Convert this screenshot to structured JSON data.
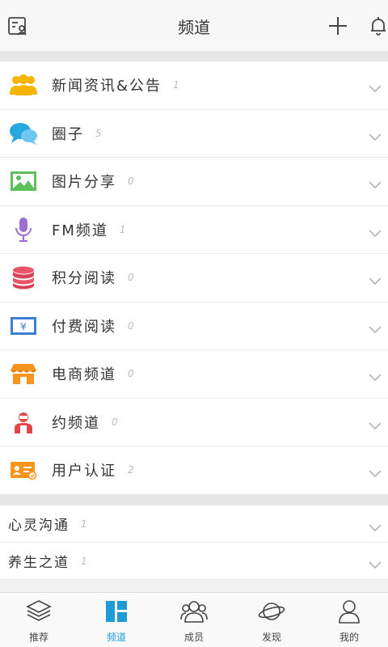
{
  "header": {
    "title": "频道"
  },
  "channels": [
    {
      "label": "新闻资讯&公告",
      "count": "1",
      "icon": "users-icon"
    },
    {
      "label": "圈子",
      "count": "5",
      "icon": "chat-bubbles-icon"
    },
    {
      "label": "图片分享",
      "count": "0",
      "icon": "image-icon"
    },
    {
      "label": "FM频道",
      "count": "1",
      "icon": "microphone-icon"
    },
    {
      "label": "积分阅读",
      "count": "0",
      "icon": "coins-stack-icon"
    },
    {
      "label": "付费阅读",
      "count": "0",
      "icon": "yen-card-icon"
    },
    {
      "label": "电商频道",
      "count": "0",
      "icon": "shop-icon"
    },
    {
      "label": "约频道",
      "count": "0",
      "icon": "person-icon"
    },
    {
      "label": "用户认证",
      "count": "2",
      "icon": "id-card-icon"
    }
  ],
  "sub_channels": [
    {
      "label": "心灵沟通",
      "count": "1"
    },
    {
      "label": "养生之道",
      "count": "1"
    }
  ],
  "tabs": [
    {
      "label": "推荐",
      "icon": "layers-icon",
      "active": false
    },
    {
      "label": "频道",
      "icon": "grid-icon",
      "active": true
    },
    {
      "label": "成员",
      "icon": "members-icon",
      "active": false
    },
    {
      "label": "发现",
      "icon": "planet-icon",
      "active": false
    },
    {
      "label": "我的",
      "icon": "profile-icon",
      "active": false
    }
  ],
  "colors": {
    "accent": "#1e9bd7",
    "users": "#f5b400",
    "chat": "#29a8e0",
    "image": "#5cc05b",
    "mic": "#9b6ed6",
    "coins": "#e9546b",
    "yen": "#3b7fd1",
    "shop": "#f7941d",
    "person": "#e04848",
    "idcard": "#f7941d"
  }
}
